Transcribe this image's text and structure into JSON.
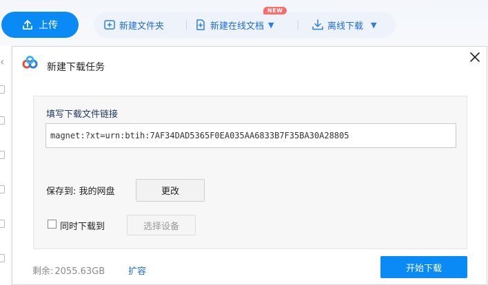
{
  "toolbar": {
    "upload_label": "上传",
    "new_folder_label": "新建文件夹",
    "new_online_doc_label": "新建在线文档",
    "new_badge": "NEW",
    "offline_download_label": "离线下载",
    "caret": "▼"
  },
  "dialog": {
    "title": "新建下载任务",
    "link_label": "填写下载文件链接",
    "link_value": "magnet:?xt=urn:btih:7AF34DAD5365F0EA035AA6833B7F35BA30A28805",
    "save_to_label": "保存到: 我的网盘",
    "change_button": "更改",
    "sync_label": "同时下载到",
    "select_device_button": "选择设备",
    "remaining_label": "剩余:",
    "remaining_value": "2055.63GB",
    "expand_link": "扩容",
    "start_button": "开始下载"
  },
  "colors": {
    "accent": "#0a8af5",
    "link": "#1c6ed8",
    "badge": "#ff6b6b"
  },
  "icons": {
    "upload": "upload-icon",
    "new_folder": "folder-plus-icon",
    "new_doc": "document-plus-icon",
    "offline": "download-icon",
    "logo": "cloud-logo-icon",
    "close": "close-icon",
    "back": "chevron-left-icon"
  }
}
